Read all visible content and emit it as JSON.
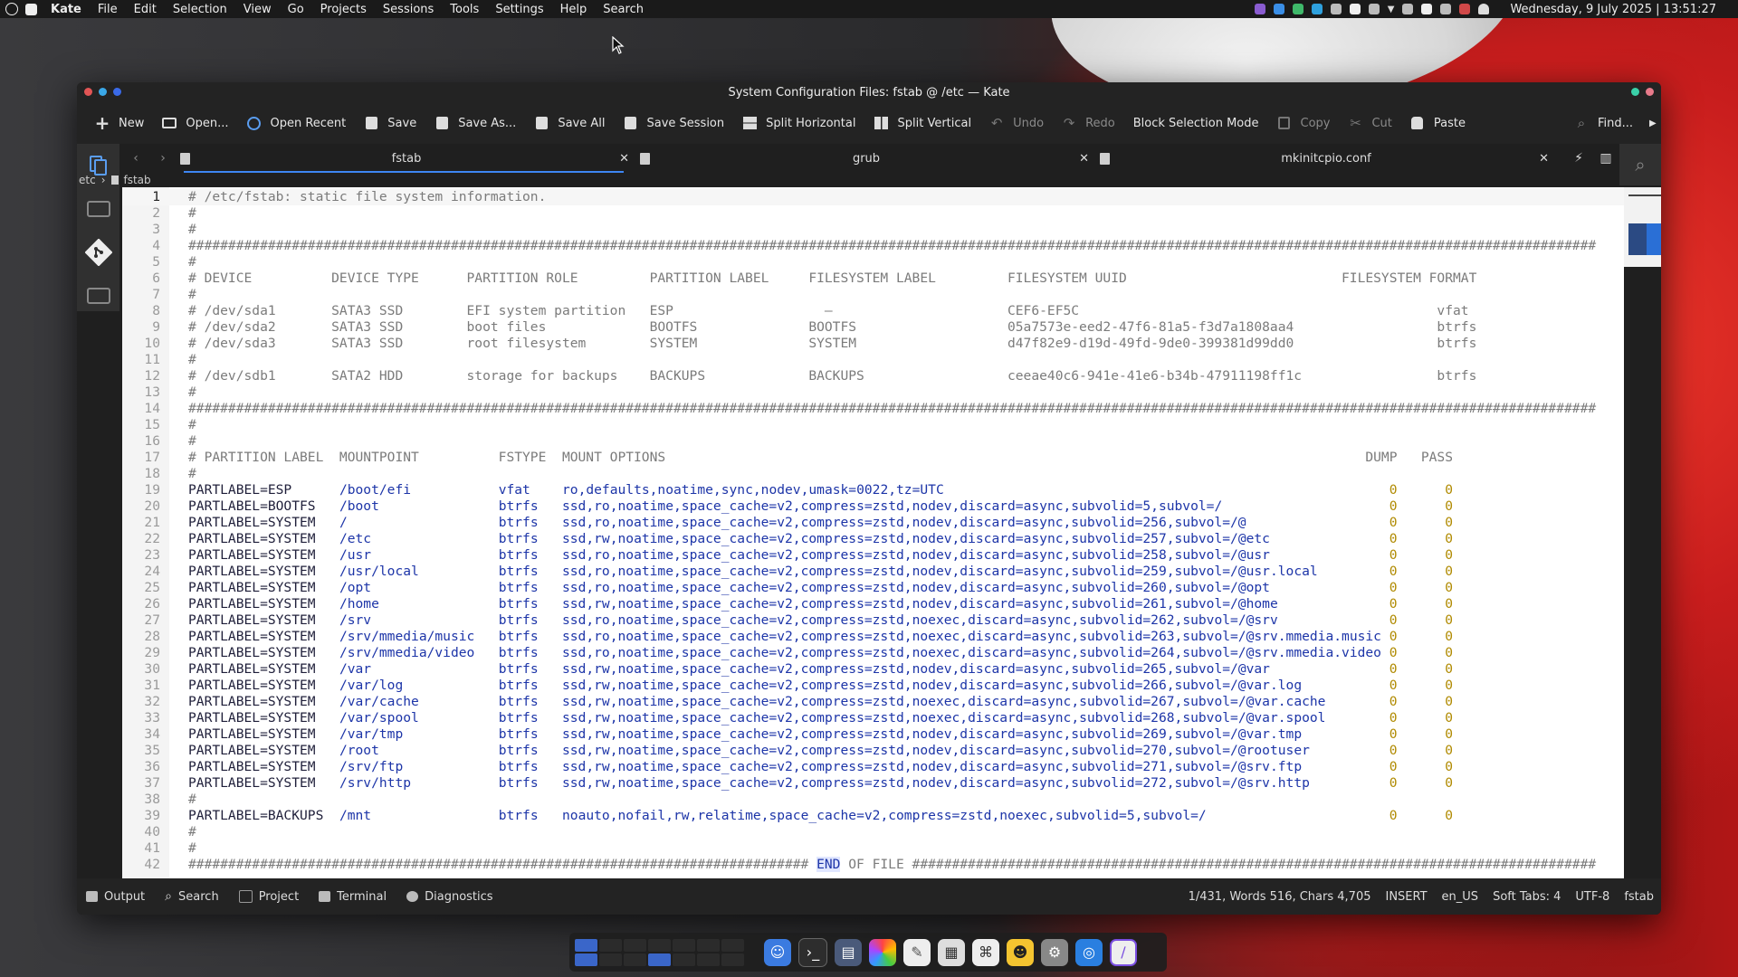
{
  "menubar": {
    "app_name": "Kate",
    "menus": [
      "File",
      "Edit",
      "Selection",
      "View",
      "Go",
      "Projects",
      "Sessions",
      "Tools",
      "Settings",
      "Help",
      "Search"
    ],
    "clock": "Wednesday, 9 July 2025 | 13:51:27"
  },
  "window": {
    "title": "System Configuration Files: fstab @ /etc — Kate"
  },
  "toolbar": {
    "new": "New",
    "open": "Open...",
    "open_recent": "Open Recent",
    "save": "Save",
    "save_as": "Save As...",
    "save_all": "Save All",
    "save_session": "Save Session",
    "split_horizontal": "Split Horizontal",
    "split_vertical": "Split Vertical",
    "undo": "Undo",
    "redo": "Redo",
    "block_selection": "Block Selection Mode",
    "copy": "Copy",
    "cut": "Cut",
    "paste": "Paste",
    "find": "Find..."
  },
  "tabs": [
    {
      "label": "fstab",
      "active": true
    },
    {
      "label": "grub",
      "active": false
    },
    {
      "label": "mkinitcpio.conf",
      "active": false
    }
  ],
  "breadcrumb": {
    "dir": "etc",
    "file": "fstab"
  },
  "editor": {
    "current_line": 1,
    "lines": [
      "# /etc/fstab: static file system information.",
      "#",
      "#",
      "#################################################################################################################################################################################",
      "#",
      "# DEVICE          DEVICE TYPE      PARTITION ROLE         PARTITION LABEL     FILESYSTEM LABEL         FILESYSTEM UUID                           FILESYSTEM FORMAT",
      "#",
      "# /dev/sda1       SATA3 SSD        EFI system partition   ESP                   —                      CEF6-EF5C                                             vfat",
      "# /dev/sda2       SATA3 SSD        boot files             BOOTFS              BOOTFS                   05a7573e-eed2-47f6-81a5-f3d7a1808aa4                  btrfs",
      "# /dev/sda3       SATA3 SSD        root filesystem        SYSTEM              SYSTEM                   d47f82e9-d19d-49fd-9de0-399381d99dd0                  btrfs",
      "#",
      "# /dev/sdb1       SATA2 HDD        storage for backups    BACKUPS             BACKUPS                  ceeae40c6-941e-41e6-b34b-47911198ff1c                 btrfs",
      "#",
      "#################################################################################################################################################################################",
      "#",
      "#",
      "# PARTITION LABEL  MOUNTPOINT          FSTYPE  MOUNT OPTIONS                                                                                        DUMP   PASS",
      "#",
      "PARTLABEL=ESP      /boot/efi           vfat    ro,defaults,noatime,sync,nodev,umask=0022,tz=UTC                                                        0      0",
      "PARTLABEL=BOOTFS   /boot               btrfs   ssd,ro,noatime,space_cache=v2,compress=zstd,nodev,discard=async,subvolid=5,subvol=/                     0      0",
      "PARTLABEL=SYSTEM   /                   btrfs   ssd,ro,noatime,space_cache=v2,compress=zstd,nodev,discard=async,subvolid=256,subvol=/@                  0      0",
      "PARTLABEL=SYSTEM   /etc                btrfs   ssd,rw,noatime,space_cache=v2,compress=zstd,nodev,discard=async,subvolid=257,subvol=/@etc               0      0",
      "PARTLABEL=SYSTEM   /usr                btrfs   ssd,ro,noatime,space_cache=v2,compress=zstd,nodev,discard=async,subvolid=258,subvol=/@usr               0      0",
      "PARTLABEL=SYSTEM   /usr/local          btrfs   ssd,ro,noatime,space_cache=v2,compress=zstd,nodev,discard=async,subvolid=259,subvol=/@usr.local         0      0",
      "PARTLABEL=SYSTEM   /opt                btrfs   ssd,ro,noatime,space_cache=v2,compress=zstd,nodev,discard=async,subvolid=260,subvol=/@opt               0      0",
      "PARTLABEL=SYSTEM   /home               btrfs   ssd,rw,noatime,space_cache=v2,compress=zstd,nodev,discard=async,subvolid=261,subvol=/@home              0      0",
      "PARTLABEL=SYSTEM   /srv                btrfs   ssd,ro,noatime,space_cache=v2,compress=zstd,noexec,discard=async,subvolid=262,subvol=/@srv              0      0",
      "PARTLABEL=SYSTEM   /srv/mmedia/music   btrfs   ssd,ro,noatime,space_cache=v2,compress=zstd,noexec,discard=async,subvolid=263,subvol=/@srv.mmedia.music 0      0",
      "PARTLABEL=SYSTEM   /srv/mmedia/video   btrfs   ssd,ro,noatime,space_cache=v2,compress=zstd,noexec,discard=async,subvolid=264,subvol=/@srv.mmedia.video 0      0",
      "PARTLABEL=SYSTEM   /var                btrfs   ssd,rw,noatime,space_cache=v2,compress=zstd,nodev,discard=async,subvolid=265,subvol=/@var               0      0",
      "PARTLABEL=SYSTEM   /var/log            btrfs   ssd,rw,noatime,space_cache=v2,compress=zstd,nodev,discard=async,subvolid=266,subvol=/@var.log           0      0",
      "PARTLABEL=SYSTEM   /var/cache          btrfs   ssd,rw,noatime,space_cache=v2,compress=zstd,noexec,discard=async,subvolid=267,subvol=/@var.cache        0      0",
      "PARTLABEL=SYSTEM   /var/spool          btrfs   ssd,rw,noatime,space_cache=v2,compress=zstd,noexec,discard=async,subvolid=268,subvol=/@var.spool        0      0",
      "PARTLABEL=SYSTEM   /var/tmp            btrfs   ssd,rw,noatime,space_cache=v2,compress=zstd,nodev,discard=async,subvolid=269,subvol=/@var.tmp           0      0",
      "PARTLABEL=SYSTEM   /root               btrfs   ssd,rw,noatime,space_cache=v2,compress=zstd,nodev,discard=async,subvolid=270,subvol=/@rootuser          0      0",
      "PARTLABEL=SYSTEM   /srv/ftp            btrfs   ssd,rw,noatime,space_cache=v2,compress=zstd,nodev,discard=async,subvolid=271,subvol=/@srv.ftp           0      0",
      "PARTLABEL=SYSTEM   /srv/http           btrfs   ssd,rw,noatime,space_cache=v2,compress=zstd,nodev,discard=async,subvolid=272,subvol=/@srv.http          0      0",
      "#",
      "PARTLABEL=BACKUPS  /mnt                btrfs   noauto,nofail,rw,relatime,space_cache=v2,compress=zstd,noexec,subvolid=5,subvol=/                       0      0",
      "#",
      "#",
      "############################################################################## END OF FILE ######################################################################################"
    ]
  },
  "statusbar": {
    "output": "Output",
    "search": "Search",
    "project": "Project",
    "terminal": "Terminal",
    "diagnostics": "Diagnostics",
    "position": "1/431, Words 516, Chars 4,705",
    "mode": "INSERT",
    "language": "en_US",
    "indent": "Soft Tabs: 4",
    "encoding": "UTF-8",
    "filetype": "fstab"
  },
  "colors": {
    "accent": "#3d86f3",
    "comment": "#7b7b7b",
    "value": "#1d35a8",
    "number": "#b08a00"
  }
}
